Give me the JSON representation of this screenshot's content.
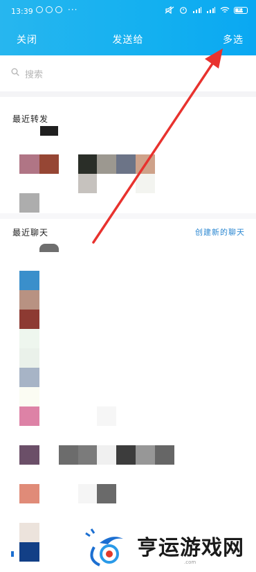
{
  "status_bar": {
    "time": "13:39",
    "more": "···",
    "battery": "81"
  },
  "header": {
    "close_label": "关闭",
    "title": "发送给",
    "multi_select_label": "多选"
  },
  "search": {
    "placeholder": "搜索"
  },
  "sections": {
    "recent_forward_title": "最近转发",
    "recent_chats_title": "最近聊天",
    "new_chat_link": "创建新的聊天"
  },
  "watermark": {
    "text": "亨运游戏网",
    "small": ".com"
  },
  "colors": {
    "header": "#13b0f0",
    "link": "#2b87d1",
    "arrow": "#e8322e"
  }
}
